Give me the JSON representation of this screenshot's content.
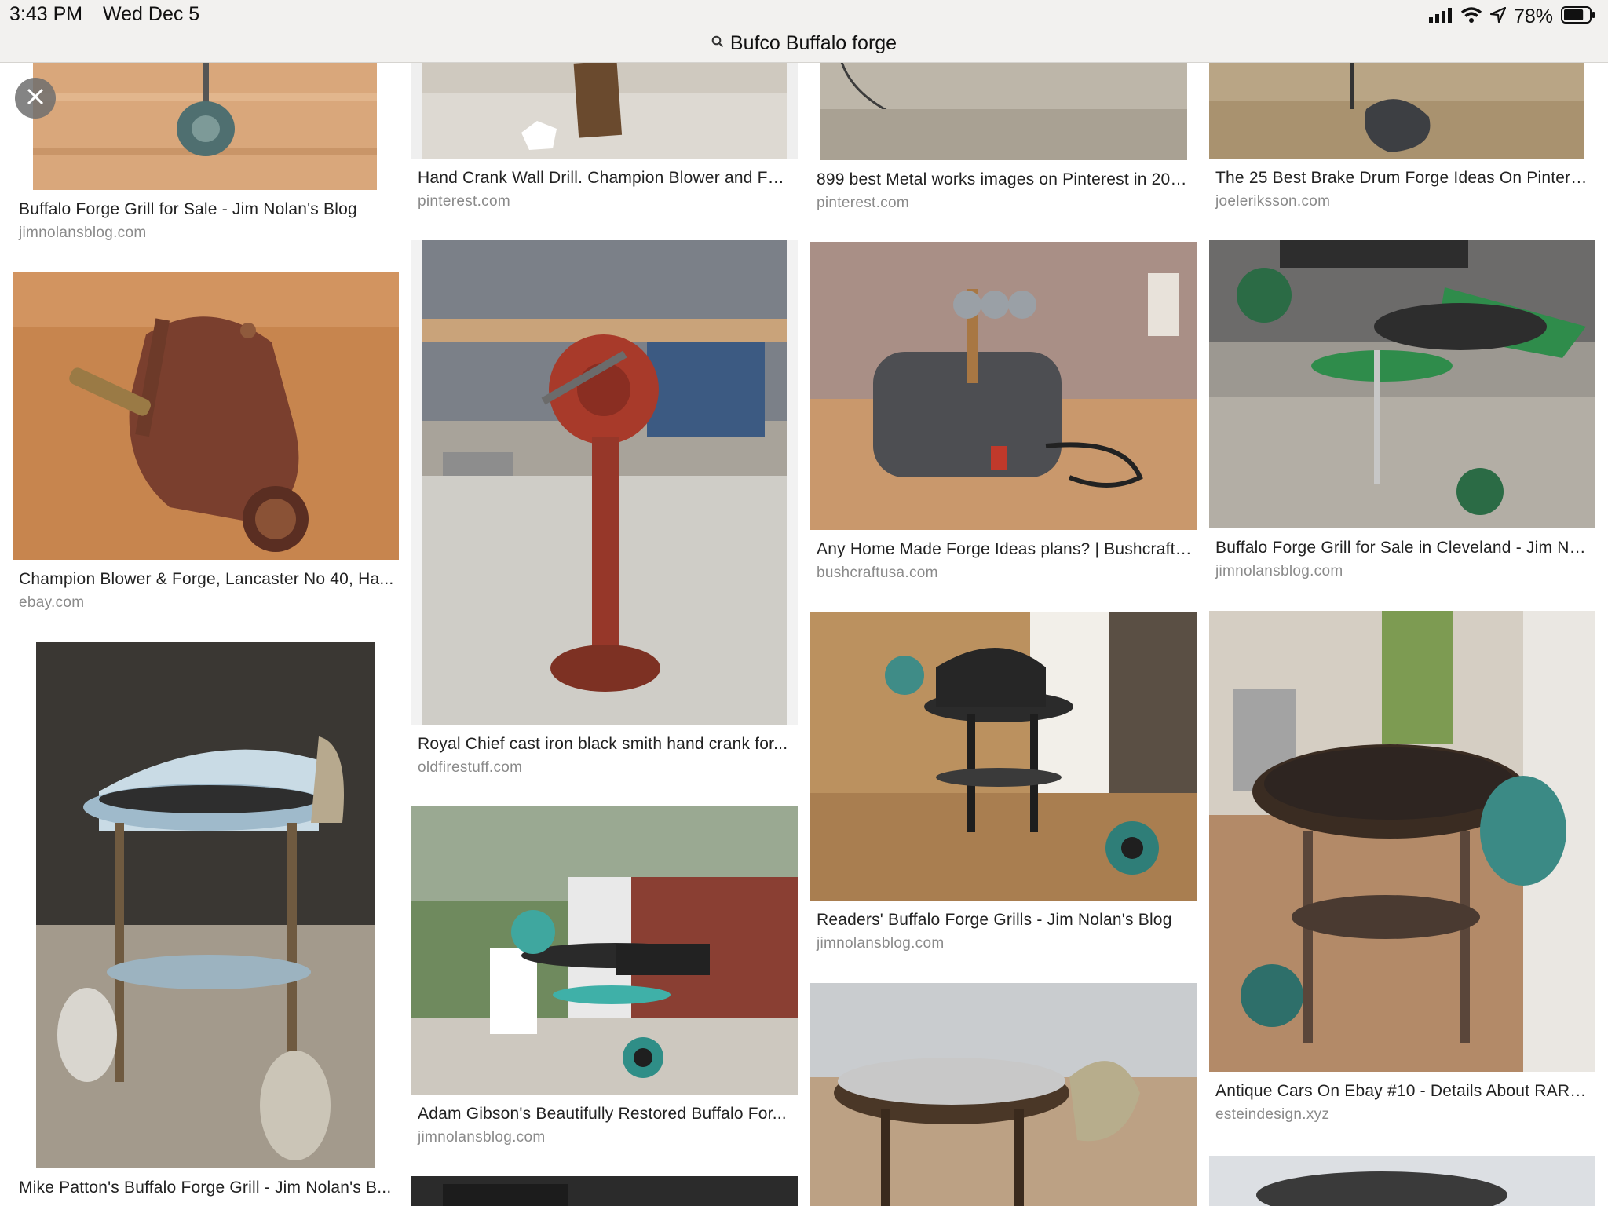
{
  "status_bar": {
    "time": "3:43 PM",
    "date": "Wed Dec 5",
    "battery_percent": "78%",
    "battery_level": 0.78,
    "icons": [
      "cellular-signal-icon",
      "wifi-icon",
      "location-arrow-icon",
      "battery-icon"
    ]
  },
  "search": {
    "query": "Bufco Buffalo forge",
    "icon": "search-icon"
  },
  "close_icon": "close-icon",
  "results": [
    {
      "title": "Buffalo Forge Grill for Sale - Jim Nolan's Blog",
      "source": "jimnolansblog.com"
    },
    {
      "title": "Champion Blower & Forge, Lancaster No 40, Ha...",
      "source": "ebay.com"
    },
    {
      "title": "Mike Patton's Buffalo Forge Grill - Jim Nolan's B...",
      "source": ""
    },
    {
      "title": "Hand Crank Wall Drill. Champion Blower and For...",
      "source": "pinterest.com"
    },
    {
      "title": "Royal Chief cast iron black smith hand crank for...",
      "source": "oldfirestuff.com"
    },
    {
      "title": "Adam Gibson's Beautifully Restored Buffalo For...",
      "source": "jimnolansblog.com"
    },
    {
      "title": "899 best Metal works images on Pinterest in 201...",
      "source": "pinterest.com"
    },
    {
      "title": "Any Home Made Forge Ideas plans? | Bushcraft ...",
      "source": "bushcraftusa.com"
    },
    {
      "title": "Readers' Buffalo Forge Grills - Jim Nolan's Blog",
      "source": "jimnolansblog.com"
    },
    {
      "title": "The 25 Best Brake Drum Forge Ideas On Pintere...",
      "source": "joeleriksson.com"
    },
    {
      "title": "Buffalo Forge Grill for Sale in Cleveland - Jim No...",
      "source": "jimnolansblog.com"
    },
    {
      "title": "Antique Cars On Ebay #10 - Details About RARE...",
      "source": "esteindesign.xyz"
    }
  ]
}
